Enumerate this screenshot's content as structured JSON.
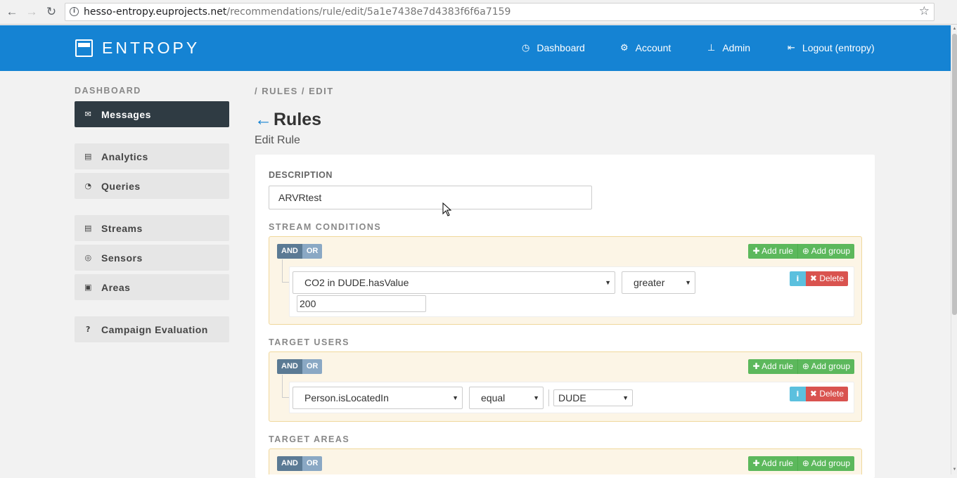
{
  "browser": {
    "url_host": "hesso-entropy.euprojects.net",
    "url_path": "/recommendations/rule/edit/5a1e7438e7d4383f6f6a7159"
  },
  "header": {
    "logo_text": "ENTROPY",
    "nav": [
      {
        "label": "Dashboard",
        "icon": "dashboard-icon"
      },
      {
        "label": "Account",
        "icon": "gear-icon"
      },
      {
        "label": "Admin",
        "icon": "pin-icon"
      },
      {
        "label": "Logout (entropy)",
        "icon": "logout-icon"
      }
    ]
  },
  "sidebar": {
    "heading": "DASHBOARD",
    "items": [
      {
        "label": "Messages",
        "icon": "envelope-icon",
        "active": true
      },
      {
        "label": "Analytics",
        "icon": "bar-chart-icon"
      },
      {
        "label": "Queries",
        "icon": "pie-chart-icon"
      },
      {
        "label": "Streams",
        "icon": "list-icon"
      },
      {
        "label": "Sensors",
        "icon": "target-icon"
      },
      {
        "label": "Areas",
        "icon": "image-icon"
      },
      {
        "label": "Campaign Evaluation",
        "icon": "question-icon"
      }
    ]
  },
  "main": {
    "breadcrumb": "/ RULES / EDIT",
    "back_arrow": "←",
    "title": "Rules",
    "subtitle": "Edit Rule",
    "description_label": "DESCRIPTION",
    "description_value": "ARVRtest",
    "stream_conditions_label": "STREAM CONDITIONS",
    "target_users_label": "TARGET USERS",
    "target_areas_label": "TARGET AREAS",
    "and_label": "AND",
    "or_label": "OR",
    "add_rule_label": "Add rule",
    "add_group_label": "Add group",
    "delete_label": "Delete",
    "stream_rule": {
      "field": "CO2 in DUDE.hasValue",
      "operator": "greater",
      "value": "200"
    },
    "users_rule": {
      "field": "Person.isLocatedIn",
      "operator": "equal",
      "value": "DUDE"
    }
  },
  "colors": {
    "brand_blue": "#1583d3",
    "sidebar_active": "#2f3b43",
    "success_green": "#5cb85c",
    "danger_red": "#d9534f",
    "info_blue": "#5bc0de",
    "group_bg": "#fcf5e6"
  }
}
